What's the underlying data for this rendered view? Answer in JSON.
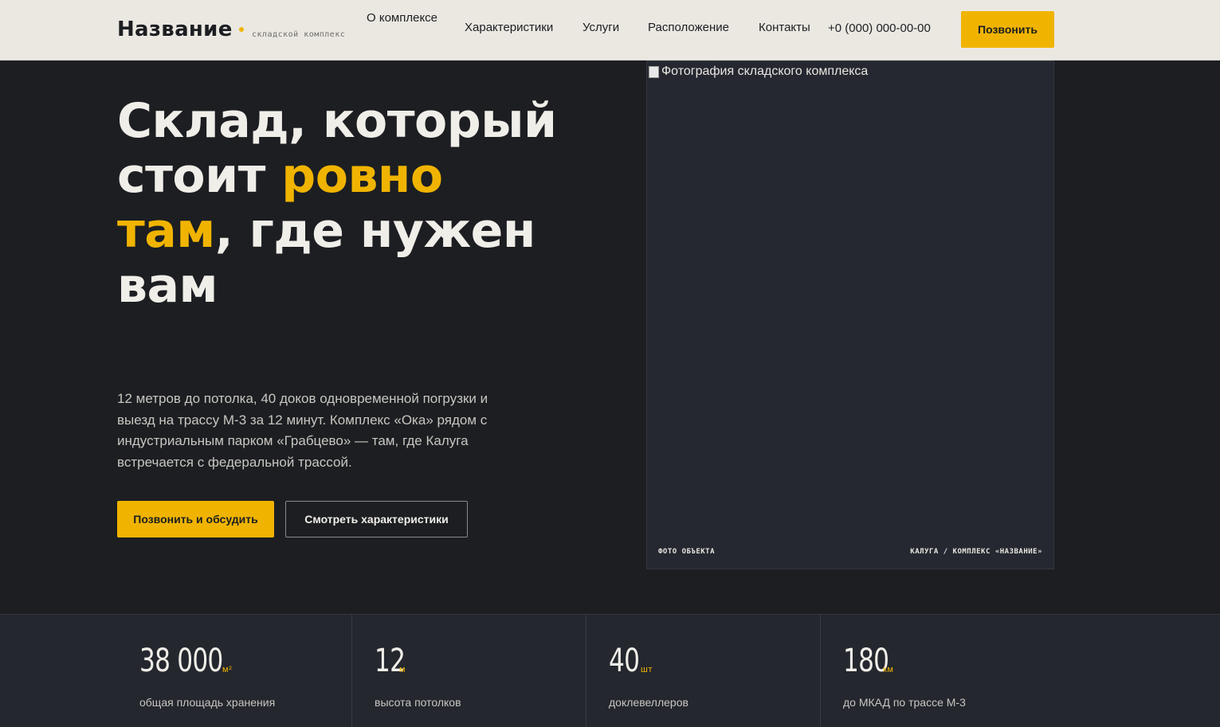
{
  "header": {
    "logo": "Название",
    "logo_sub": "складской комплекс",
    "nav": [
      "О комплексе",
      "Характеристики",
      "Услуги",
      "Расположение",
      "Контакты"
    ],
    "phone": "+0 (000) 000-00-00",
    "call_button": "Позвонить"
  },
  "hero": {
    "title_part1": "Склад, который стоит ",
    "title_accent1": "ровно там",
    "title_part2": ", где нужен вам",
    "description": "12 метров до потолка, 40 доков одновременной погрузки и выезд на трассу М-3 за 12 минут. Комплекс «Ока» рядом с индустриальным парком «Грабцево» — там, где Калуга встречается с федеральной трассой.",
    "primary_button": "Позвонить и обсудить",
    "secondary_button": "Смотреть характеристики"
  },
  "photo": {
    "alt": "Фотография складского комплекса",
    "label_left": "ФОТО ОБЪЕКТА",
    "label_right": "КАЛУГА / КОМПЛЕКС «НАЗВАНИЕ»"
  },
  "stats": [
    {
      "value": "38 000",
      "unit": "м²",
      "label": "общая площадь хранения"
    },
    {
      "value": "12",
      "unit": "м",
      "label": "высота потолков"
    },
    {
      "value": "40",
      "unit": "шт",
      "label": "доклевеллеров"
    },
    {
      "value": "180",
      "unit": "км",
      "label": "до МКАД по трассе М-3"
    }
  ],
  "colors": {
    "accent": "#f0b400",
    "dark_bg": "#1c1e22",
    "header_bg": "#ebe8e2"
  }
}
